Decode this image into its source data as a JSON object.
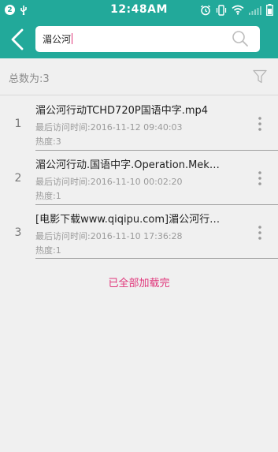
{
  "status_bar": {
    "notification_count": "2",
    "time": "12:48AM"
  },
  "search": {
    "query": "湄公河"
  },
  "results": {
    "count_label": "总数为:3",
    "items": [
      {
        "index": "1",
        "title": "湄公河行动TCHD720P国语中字.mp4",
        "time": "最后访问时间:2016-11-12 09:40:03",
        "heat": "热度:3"
      },
      {
        "index": "2",
        "title": "湄公河行动.国语中字.Operation.Mek…",
        "time": "最后访问时间:2016-11-10 00:02:20",
        "heat": "热度:1"
      },
      {
        "index": "3",
        "title": "[电影下载www.qiqipu.com]湄公河行…",
        "time": "最后访问时间:2016-11-10 17:36:28",
        "heat": "热度:1"
      }
    ],
    "footer": "已全部加载完"
  },
  "colors": {
    "accent": "#22a99a",
    "highlight": "#e0357a"
  },
  "icons": [
    "notification-badge",
    "usb-icon",
    "alarm-icon",
    "vibrate-icon",
    "wifi-icon",
    "signal-icon",
    "battery-icon",
    "back-arrow-icon",
    "search-icon",
    "filter-icon",
    "more-vertical-icon"
  ]
}
